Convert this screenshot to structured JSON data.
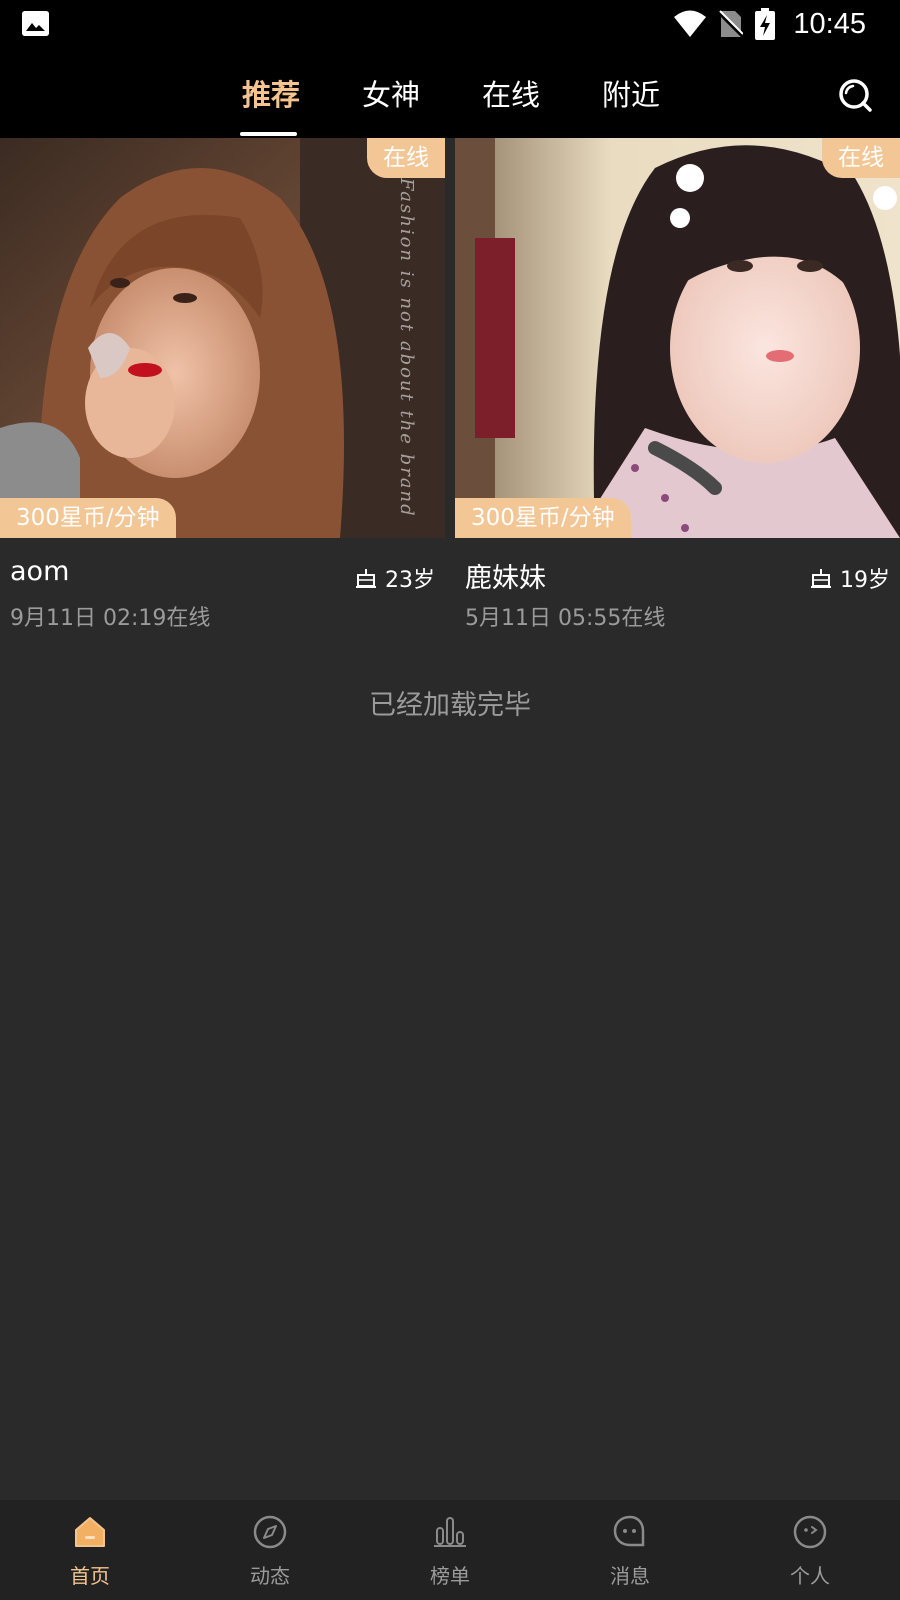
{
  "status_bar": {
    "time": "10:45",
    "icons": [
      "image-icon",
      "wifi-icon",
      "no-sim-icon",
      "battery-charging-icon"
    ]
  },
  "header": {
    "tabs": [
      {
        "label": "推荐",
        "active": true
      },
      {
        "label": "女神",
        "active": false
      },
      {
        "label": "在线",
        "active": false
      },
      {
        "label": "附近",
        "active": false
      }
    ],
    "search_icon": "search-icon",
    "accent_color": "#f4c48f"
  },
  "cards": [
    {
      "online_badge": "在线",
      "price": "300星币/分钟",
      "photo_text": "Fashion is not about the brand",
      "name": "aom",
      "age": "23岁",
      "last_online": "9月11日 02:19在线"
    },
    {
      "online_badge": "在线",
      "price": "300星币/分钟",
      "name": "鹿妹妹",
      "age": "19岁",
      "last_online": "5月11日 05:55在线"
    }
  ],
  "list_footer": "已经加载完毕",
  "bottom_nav": [
    {
      "label": "首页",
      "icon": "home-icon",
      "active": true
    },
    {
      "label": "动态",
      "icon": "compass-icon",
      "active": false
    },
    {
      "label": "榜单",
      "icon": "bar-chart-icon",
      "active": false
    },
    {
      "label": "消息",
      "icon": "chat-bubble-icon",
      "active": false
    },
    {
      "label": "个人",
      "icon": "profile-face-icon",
      "active": false
    }
  ],
  "colors": {
    "badge": "#f3c695",
    "background": "#2a2a2a",
    "secondary_text": "#9b9b9b"
  }
}
